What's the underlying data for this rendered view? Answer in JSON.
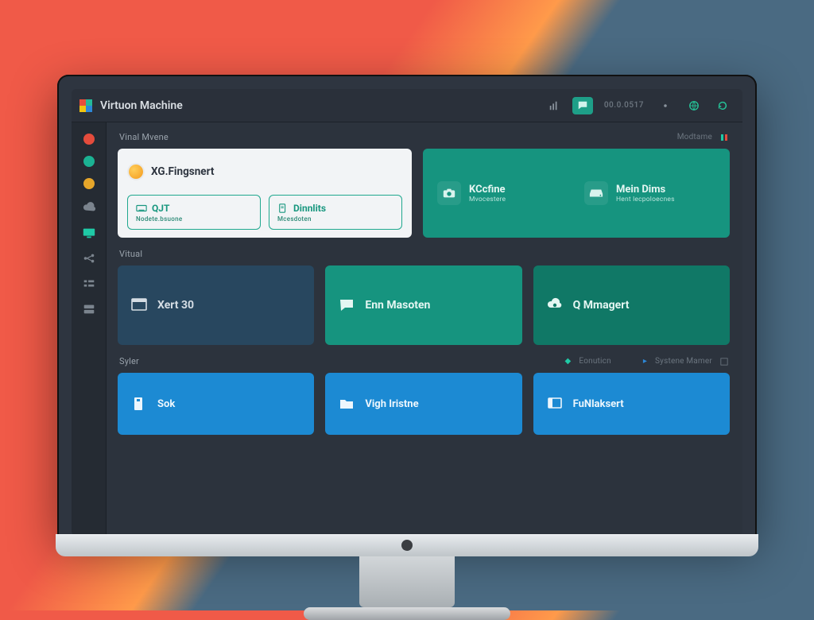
{
  "header": {
    "title": "Virtuon Machine",
    "stats_label": "00.0.0517"
  },
  "sections": {
    "top_left": "Vinal Mvene",
    "top_right": "Modtame",
    "mid": "Vitual",
    "bottom_left": "Syler",
    "bottom_mid": "Eonuticn",
    "bottom_right": "Systene Mamer"
  },
  "card_management": {
    "title": "XG.Fingsnert",
    "chip1": {
      "label": "QJT",
      "sub": "Nodete.bsuone"
    },
    "chip2": {
      "label": "Dinnlits",
      "sub": "Mcesdoten"
    }
  },
  "card_status": {
    "item1": {
      "title": "KCcfine",
      "sub": "Mvocestere"
    },
    "item2": {
      "title": "Mein Dims",
      "sub": "Hent lecpoloecnes"
    }
  },
  "tiles_mid": {
    "t1": "Xert 30",
    "t2": "Enn Masoten",
    "t3": "Q Mmagert"
  },
  "tiles_bottom": {
    "b1": "Sok",
    "b2": "Vigh Iristne",
    "b3": "FuNlaksert"
  }
}
